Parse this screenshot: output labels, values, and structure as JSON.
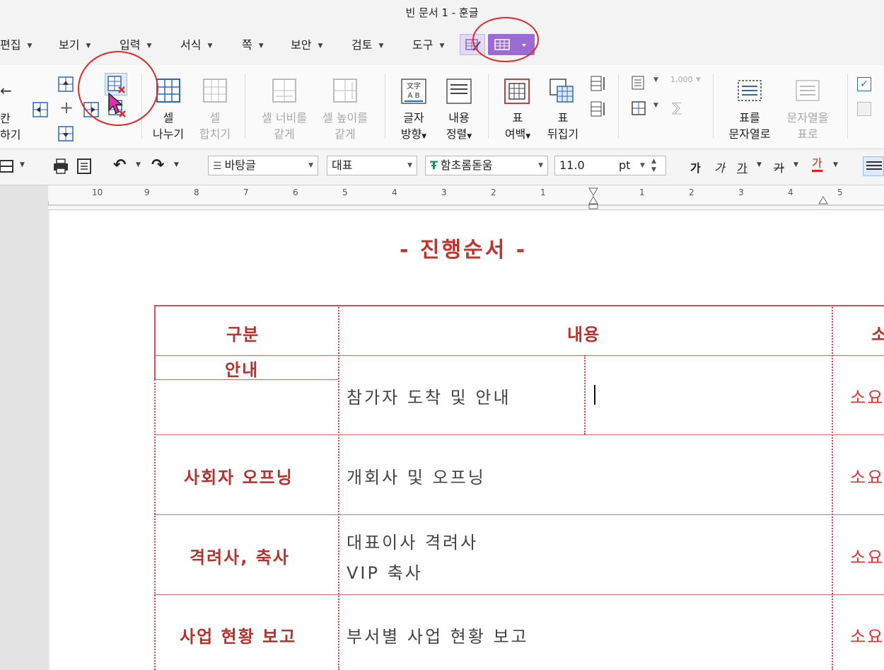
{
  "window": {
    "title": "빈 문서 1 - 훈글"
  },
  "menu": [
    "편집",
    "보기",
    "입력",
    "서식",
    "쪽",
    "보안",
    "검토",
    "도구"
  ],
  "ribbon": {
    "left_labels": [
      "칸",
      "하기"
    ],
    "split_cell": [
      "셀",
      "나누기"
    ],
    "merge_cell": [
      "셀",
      "합치기"
    ],
    "cell_width": [
      "셀 너비를",
      "같게"
    ],
    "cell_height": [
      "셀 높이를",
      "같게"
    ],
    "text_dir_icon": "文字 A B",
    "text_dir": [
      "글자",
      "방향"
    ],
    "content_align": [
      "내용",
      "정렬"
    ],
    "table_margin": [
      "표",
      "여백"
    ],
    "table_flip": [
      "표",
      "뒤집기"
    ],
    "num_icon": "1,000",
    "table_to_text": [
      "표를",
      "문자열로"
    ],
    "text_to_table": [
      "문자열을",
      "표로"
    ]
  },
  "format": {
    "style": "바탕글",
    "language": "대표",
    "font": "함초롬돋움",
    "size": "11.0",
    "unit": "pt",
    "bold": "가",
    "italic": "가",
    "underline": "가",
    "strike": "가",
    "color": "가"
  },
  "ruler": {
    "labels": [
      "10",
      "9",
      "8",
      "7",
      "6",
      "5",
      "4",
      "3",
      "2",
      "1",
      "1",
      "2",
      "3",
      "4",
      "5"
    ]
  },
  "document": {
    "title": "- 진행순서 -",
    "header": {
      "col1": "구분",
      "col2": "내용",
      "col3": "소"
    },
    "rows": [
      {
        "label": "안내",
        "content": [
          "참가자 도착 및 안내"
        ],
        "req": "소요"
      },
      {
        "label": "사회자 오프닝",
        "content": [
          "개회사 및 오프닝"
        ],
        "req": "소요"
      },
      {
        "label": "격려사, 축사",
        "content": [
          "대표이사 격려사",
          "VIP 축사"
        ],
        "req": "소요"
      },
      {
        "label": "사업 현황 보고",
        "content": [
          "부서별 사업 현황 보고"
        ],
        "req": "소요"
      }
    ]
  },
  "colors": {
    "accent": "#c0332e",
    "table_line": "#d1505a",
    "purple_tab": "#9b6ad2",
    "annotation": "#e02a2a"
  }
}
